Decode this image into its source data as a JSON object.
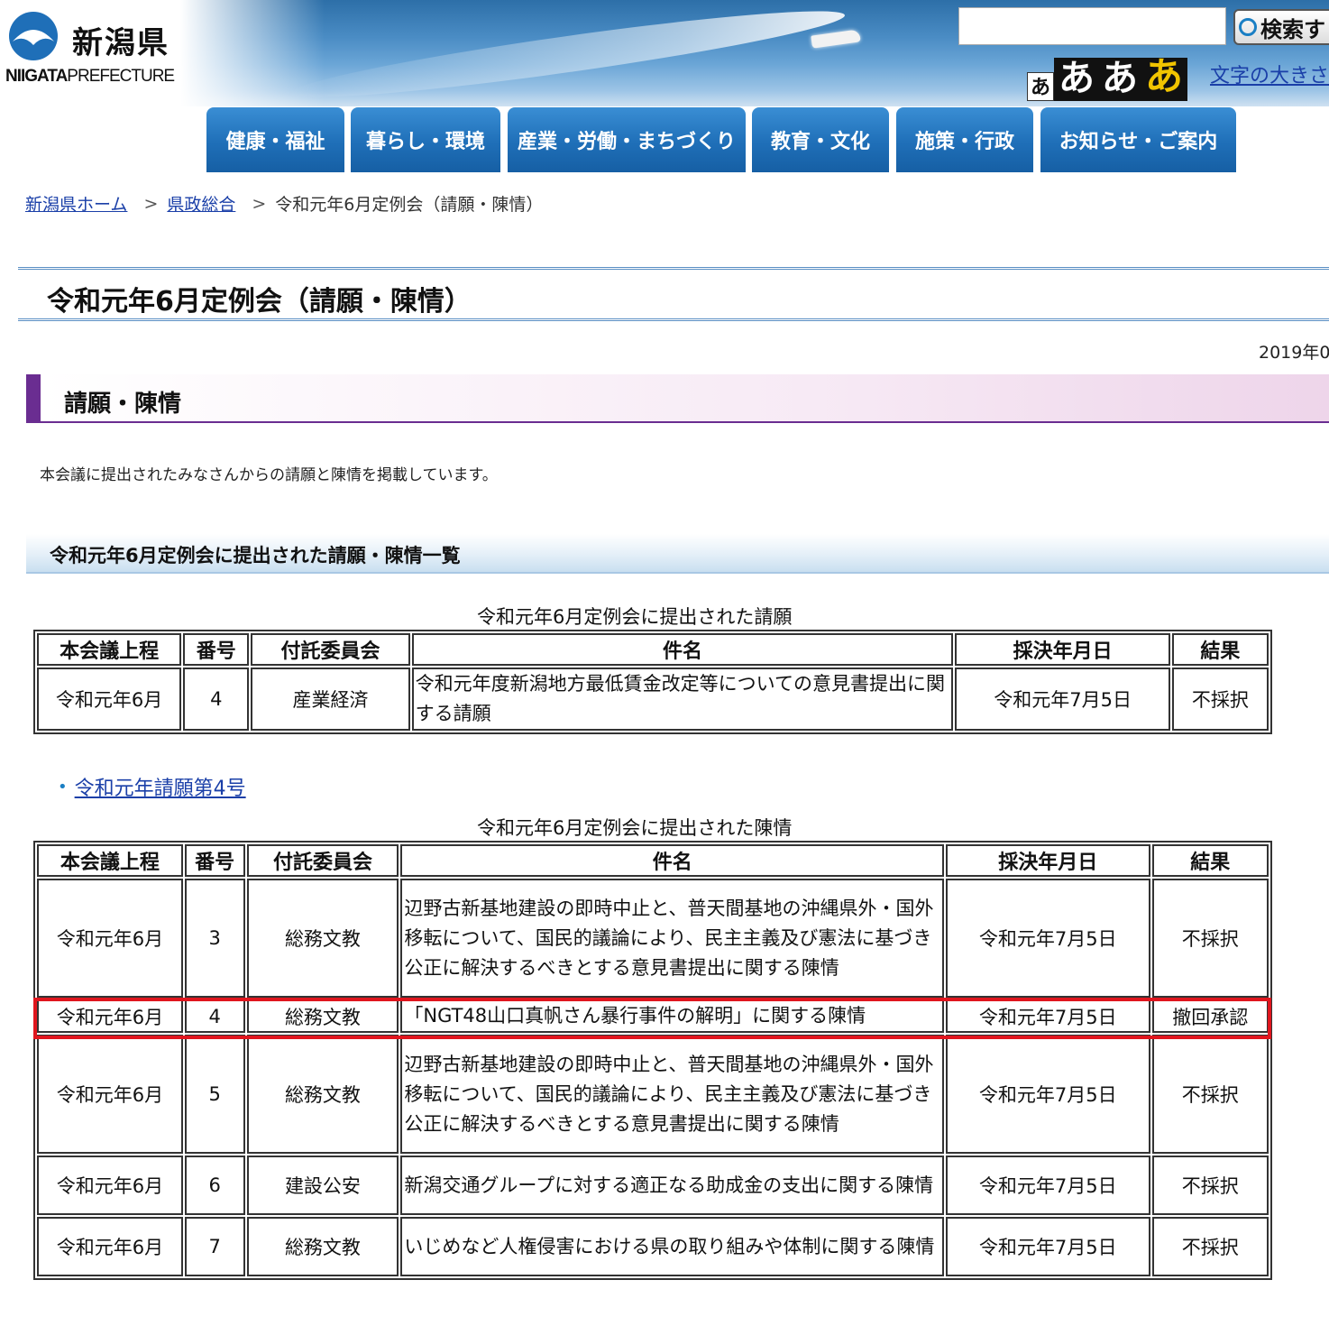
{
  "header": {
    "logo_jp": "新潟県",
    "logo_en_bold": "NIIGATA",
    "logo_en_light": "PREFECTURE",
    "search_placeholder": "",
    "search_button": "検索す",
    "font_sizes": [
      "あ",
      "あ",
      "あ",
      "あ"
    ],
    "font_size_link": "文字の大きさ",
    "brand_color": "#1f6fb8"
  },
  "nav": [
    "健康・福祉",
    "暮らし・環境",
    "産業・労働・まちづくり",
    "教育・文化",
    "施策・行政",
    "お知らせ・ご案内"
  ],
  "breadcrumb": {
    "home": "新潟県ホーム",
    "parent": "県政総合",
    "current": "令和元年6月定例会（請願・陳情）",
    "sep": ">"
  },
  "page": {
    "title": "令和元年6月定例会（請願・陳情）",
    "date": "2019年0",
    "section_heading": "請願・陳情",
    "intro": "本会議に提出されたみなさんからの請願と陳情を掲載しています。",
    "list_heading": "令和元年6月定例会に提出された請願・陳情一覧"
  },
  "petitions": {
    "caption": "令和元年6月定例会に提出された請願",
    "headers": [
      "本会議上程",
      "番号",
      "付託委員会",
      "件名",
      "採決年月日",
      "結果"
    ],
    "rows": [
      {
        "session": "令和元年6月",
        "number": "4",
        "committee": "産業経済",
        "subject": "令和元年度新潟地方最低賃金改定等についての意見書提出に関する請願",
        "date": "令和元年7月5日",
        "result": "不採択"
      }
    ]
  },
  "petition_link": "令和元年請願第4号",
  "appeals": {
    "caption": "令和元年6月定例会に提出された陳情",
    "headers": [
      "本会議上程",
      "番号",
      "付託委員会",
      "件名",
      "採決年月日",
      "結果"
    ],
    "rows": [
      {
        "session": "令和元年6月",
        "number": "3",
        "committee": "総務文教",
        "subject": "辺野古新基地建設の即時中止と、普天間基地の沖縄県外・国外移転について、国民的議論により、民主主義及び憲法に基づき公正に解決するべきとする意見書提出に関する陳情",
        "date": "令和元年7月5日",
        "result": "不採択"
      },
      {
        "session": "令和元年6月",
        "number": "4",
        "committee": "総務文教",
        "subject": "「NGT48山口真帆さん暴行事件の解明」に関する陳情",
        "date": "令和元年7月5日",
        "result": "撤回承認"
      },
      {
        "session": "令和元年6月",
        "number": "5",
        "committee": "総務文教",
        "subject": "辺野古新基地建設の即時中止と、普天間基地の沖縄県外・国外移転について、国民的議論により、民主主義及び憲法に基づき公正に解決するべきとする意見書提出に関する陳情",
        "date": "令和元年7月5日",
        "result": "不採択"
      },
      {
        "session": "令和元年6月",
        "number": "6",
        "committee": "建設公安",
        "subject": "新潟交通グループに対する適正なる助成金の支出に関する陳情",
        "date": "令和元年7月5日",
        "result": "不採択"
      },
      {
        "session": "令和元年6月",
        "number": "7",
        "committee": "総務文教",
        "subject": "いじめなど人権侵害における県の取り組みや体制に関する陳情",
        "date": "令和元年7月5日",
        "result": "不採択"
      }
    ]
  },
  "highlight_color": "#e0161e"
}
